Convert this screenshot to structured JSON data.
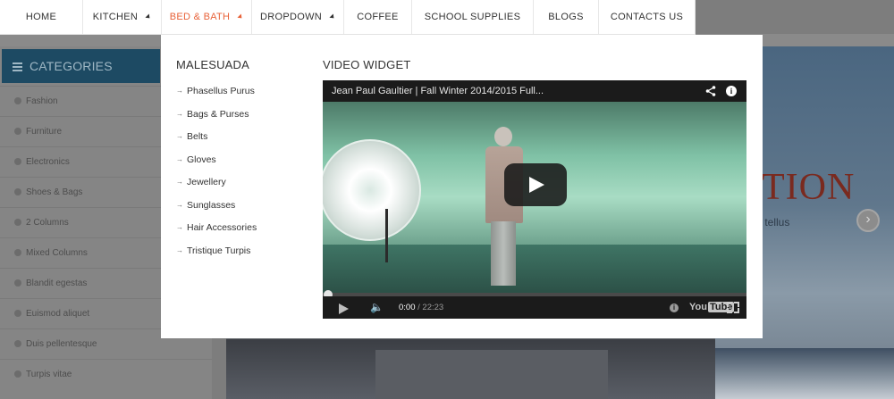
{
  "nav": {
    "items": [
      {
        "label": "HOME",
        "dropdown": false
      },
      {
        "label": "KITCHEN",
        "dropdown": true
      },
      {
        "label": "BED & BATH",
        "dropdown": true
      },
      {
        "label": "DROPDOWN",
        "dropdown": true
      },
      {
        "label": "COFFEE",
        "dropdown": false
      },
      {
        "label": "SCHOOL SUPPLIES",
        "dropdown": false
      },
      {
        "label": "BLOGS",
        "dropdown": false
      },
      {
        "label": "CONTACTS US",
        "dropdown": false
      }
    ],
    "active_index": 2
  },
  "mega_menu": {
    "col1_title": "MALESUADA",
    "links": [
      "Phasellus Purus",
      "Bags & Purses",
      "Belts",
      "Gloves",
      "Jewellery",
      "Sunglasses",
      "Hair Accessories",
      "Tristique Turpis"
    ],
    "col2_title": "VIDEO WIDGET",
    "video": {
      "title": "Jean Paul Gaultier | Fall Winter 2014/2015 Full...",
      "current_time": "0:00",
      "duration": "/ 22:23",
      "brand_you": "You",
      "brand_tube": "Tube",
      "progress": 0.0
    }
  },
  "sidebar": {
    "title": "CATEGORIES",
    "items": [
      "Fashion",
      "Furniture",
      "Electronics",
      "Shoes & Bags",
      "2 Columns",
      "Mixed Columns",
      "Blandit egestas",
      "Euismod aliquet",
      "Duis pellentesque",
      "Turpis vitae"
    ]
  },
  "banner": {
    "title": "TION",
    "subtitle": "c tellus"
  },
  "colors": {
    "accent": "#e8633a",
    "sidebar_header": "#1d4a63"
  }
}
